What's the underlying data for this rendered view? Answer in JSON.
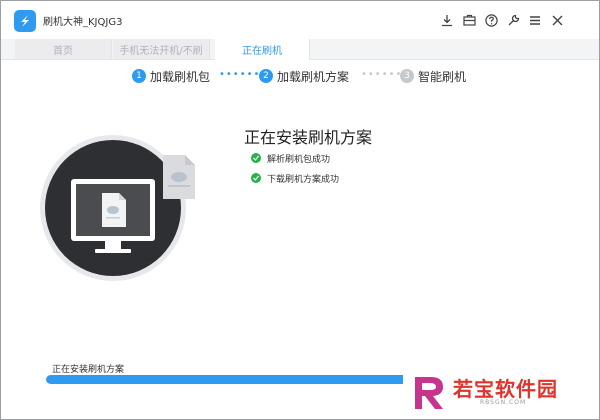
{
  "window": {
    "title": "刷机大神_KJQJG3",
    "toolbar_icons": [
      "download-icon",
      "toolbox-icon",
      "help-icon",
      "wrench-icon",
      "menu-icon",
      "close-icon"
    ]
  },
  "tabs": [
    {
      "label": "首页",
      "active": false
    },
    {
      "label": "手机无法开机/不刷",
      "active": false
    },
    {
      "label": "正在刷机",
      "active": true
    }
  ],
  "steps": [
    {
      "number": "1",
      "label": "加载刷机包",
      "state": "done"
    },
    {
      "number": "2",
      "label": "加载刷机方案",
      "state": "current"
    },
    {
      "number": "3",
      "label": "智能刷机",
      "state": "pending"
    }
  ],
  "status": {
    "title": "正在安装刷机方案",
    "items": [
      {
        "text": "解析刷机包成功",
        "icon": "check-icon"
      },
      {
        "text": "下载刷机方案成功",
        "icon": "check-icon"
      }
    ]
  },
  "progress": {
    "label": "正在安装刷机方案",
    "fraction": 0.82
  },
  "watermark": {
    "text": "若宝软件园",
    "sub": "RBSGN.COM"
  },
  "colors": {
    "accent": "#2f9bf0",
    "success": "#25b24a",
    "pending": "#c5c9ce",
    "circle": "#2e2f33",
    "watermark": "#e0332b"
  }
}
